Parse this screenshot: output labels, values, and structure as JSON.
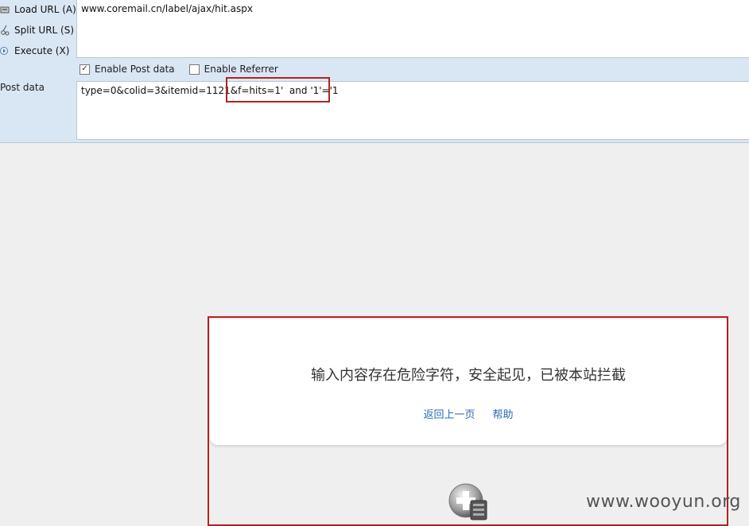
{
  "hackbar": {
    "load_url": "Load URL (A)",
    "split_url": "Split URL (S)",
    "execute": "Execute (X)",
    "url_value": "www.coremail.cn/label/ajax/hit.aspx",
    "enable_post": "Enable Post data",
    "enable_post_checked": true,
    "enable_referrer": "Enable Referrer",
    "enable_referrer_checked": false,
    "post_label": "Post data",
    "post_value": "type=0&colid=3&itemid=1121&f=hits=1'  and '1'='1"
  },
  "block_page": {
    "message": "输入内容存在危险字符，安全起见，已被本站拦截",
    "back_link": "返回上一页",
    "help_link": "帮助"
  },
  "watermark": "www.wooyun.org",
  "colors": {
    "highlight_border": "#b42222",
    "link": "#2a6bb8",
    "toolbar_bg": "#d9e6f3"
  }
}
